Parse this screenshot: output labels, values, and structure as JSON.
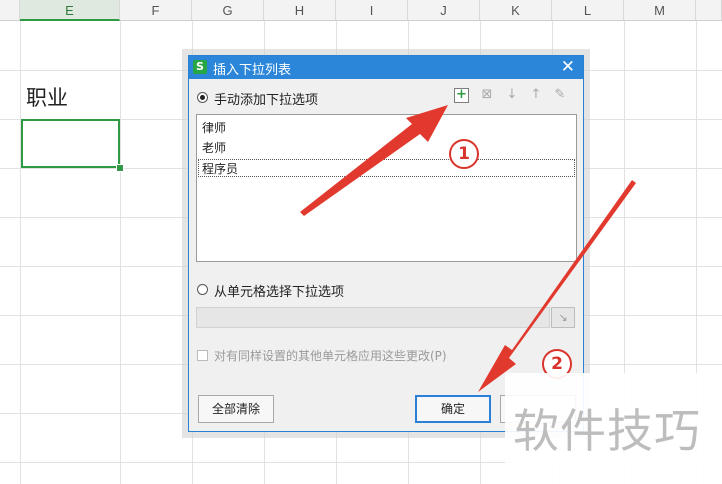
{
  "spreadsheet": {
    "columns": [
      "E",
      "F",
      "G",
      "H",
      "I",
      "J",
      "K",
      "L",
      "M"
    ],
    "selected_column": "E",
    "cell_text": "职业"
  },
  "dialog": {
    "title": "插入下拉列表",
    "app_icon_letter": "S",
    "close_glyph": "✕",
    "manual_option_label": "手动添加下拉选项",
    "tools": {
      "add": "+",
      "delete": "⊠",
      "move_down": "↓",
      "move_up": "↑",
      "edit": "✎"
    },
    "list_items": [
      "律师",
      "老师",
      "程序员"
    ],
    "selected_item_index": 2,
    "range_option_label": "从单元格选择下拉选项",
    "range_button_glyph": "↘",
    "apply_checkbox_label": "对有同样设置的其他单元格应用这些更改(P)",
    "clear_all_button": "全部清除",
    "ok_button": "确定"
  },
  "annotations": {
    "badge_1": "1",
    "badge_2": "2",
    "arrow_color": "#e2392e"
  },
  "watermark": "软件技巧"
}
